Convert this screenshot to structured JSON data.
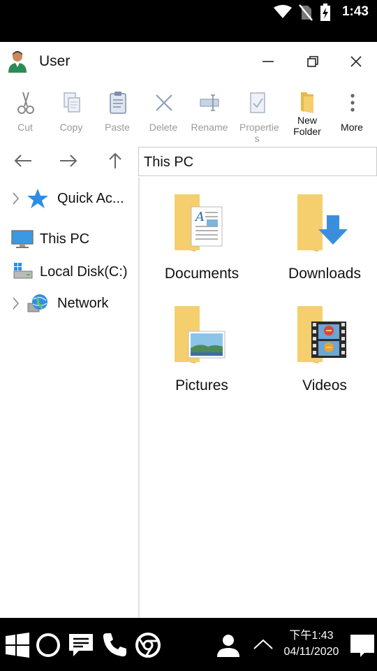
{
  "status_bar": {
    "time": "1:43",
    "icons": [
      "wifi-icon",
      "no-sim-icon",
      "battery-charging-icon"
    ]
  },
  "window": {
    "title": "User",
    "controls": [
      "minimize-icon",
      "restore-icon",
      "close-icon"
    ]
  },
  "toolbar": {
    "cut": "Cut",
    "copy": "Copy",
    "paste": "Paste",
    "delete": "Delete",
    "rename": "Rename",
    "properties": "Propertie s",
    "new_folder": "New Folder",
    "more": "More"
  },
  "nav": {
    "path": "This PC"
  },
  "sidebar": {
    "items": [
      {
        "label": "Quick Ac...",
        "icon": "star-icon"
      },
      {
        "label": "This PC",
        "icon": "monitor-icon"
      },
      {
        "label": "Local Disk(C:)",
        "icon": "drive-icon"
      },
      {
        "label": "Network",
        "icon": "globe-icon"
      }
    ]
  },
  "content": {
    "folders": [
      {
        "label": "Documents",
        "icon": "documents-folder-icon"
      },
      {
        "label": "Downloads",
        "icon": "downloads-folder-icon"
      },
      {
        "label": "Pictures",
        "icon": "pictures-folder-icon"
      },
      {
        "label": "Videos",
        "icon": "videos-folder-icon"
      }
    ]
  },
  "taskbar": {
    "time": "下午1:43",
    "date": "04/11/2020",
    "icons": [
      "windows-start-icon",
      "cortana-icon",
      "messages-icon",
      "phone-icon",
      "browser-icon",
      "person-icon",
      "chevron-up-icon",
      "notification-icon"
    ]
  },
  "colors": {
    "folder": "#f5cf6d",
    "folder_dark": "#e8b84a",
    "accent": "#3a8fdc",
    "disabled": "#9a9a9a"
  }
}
